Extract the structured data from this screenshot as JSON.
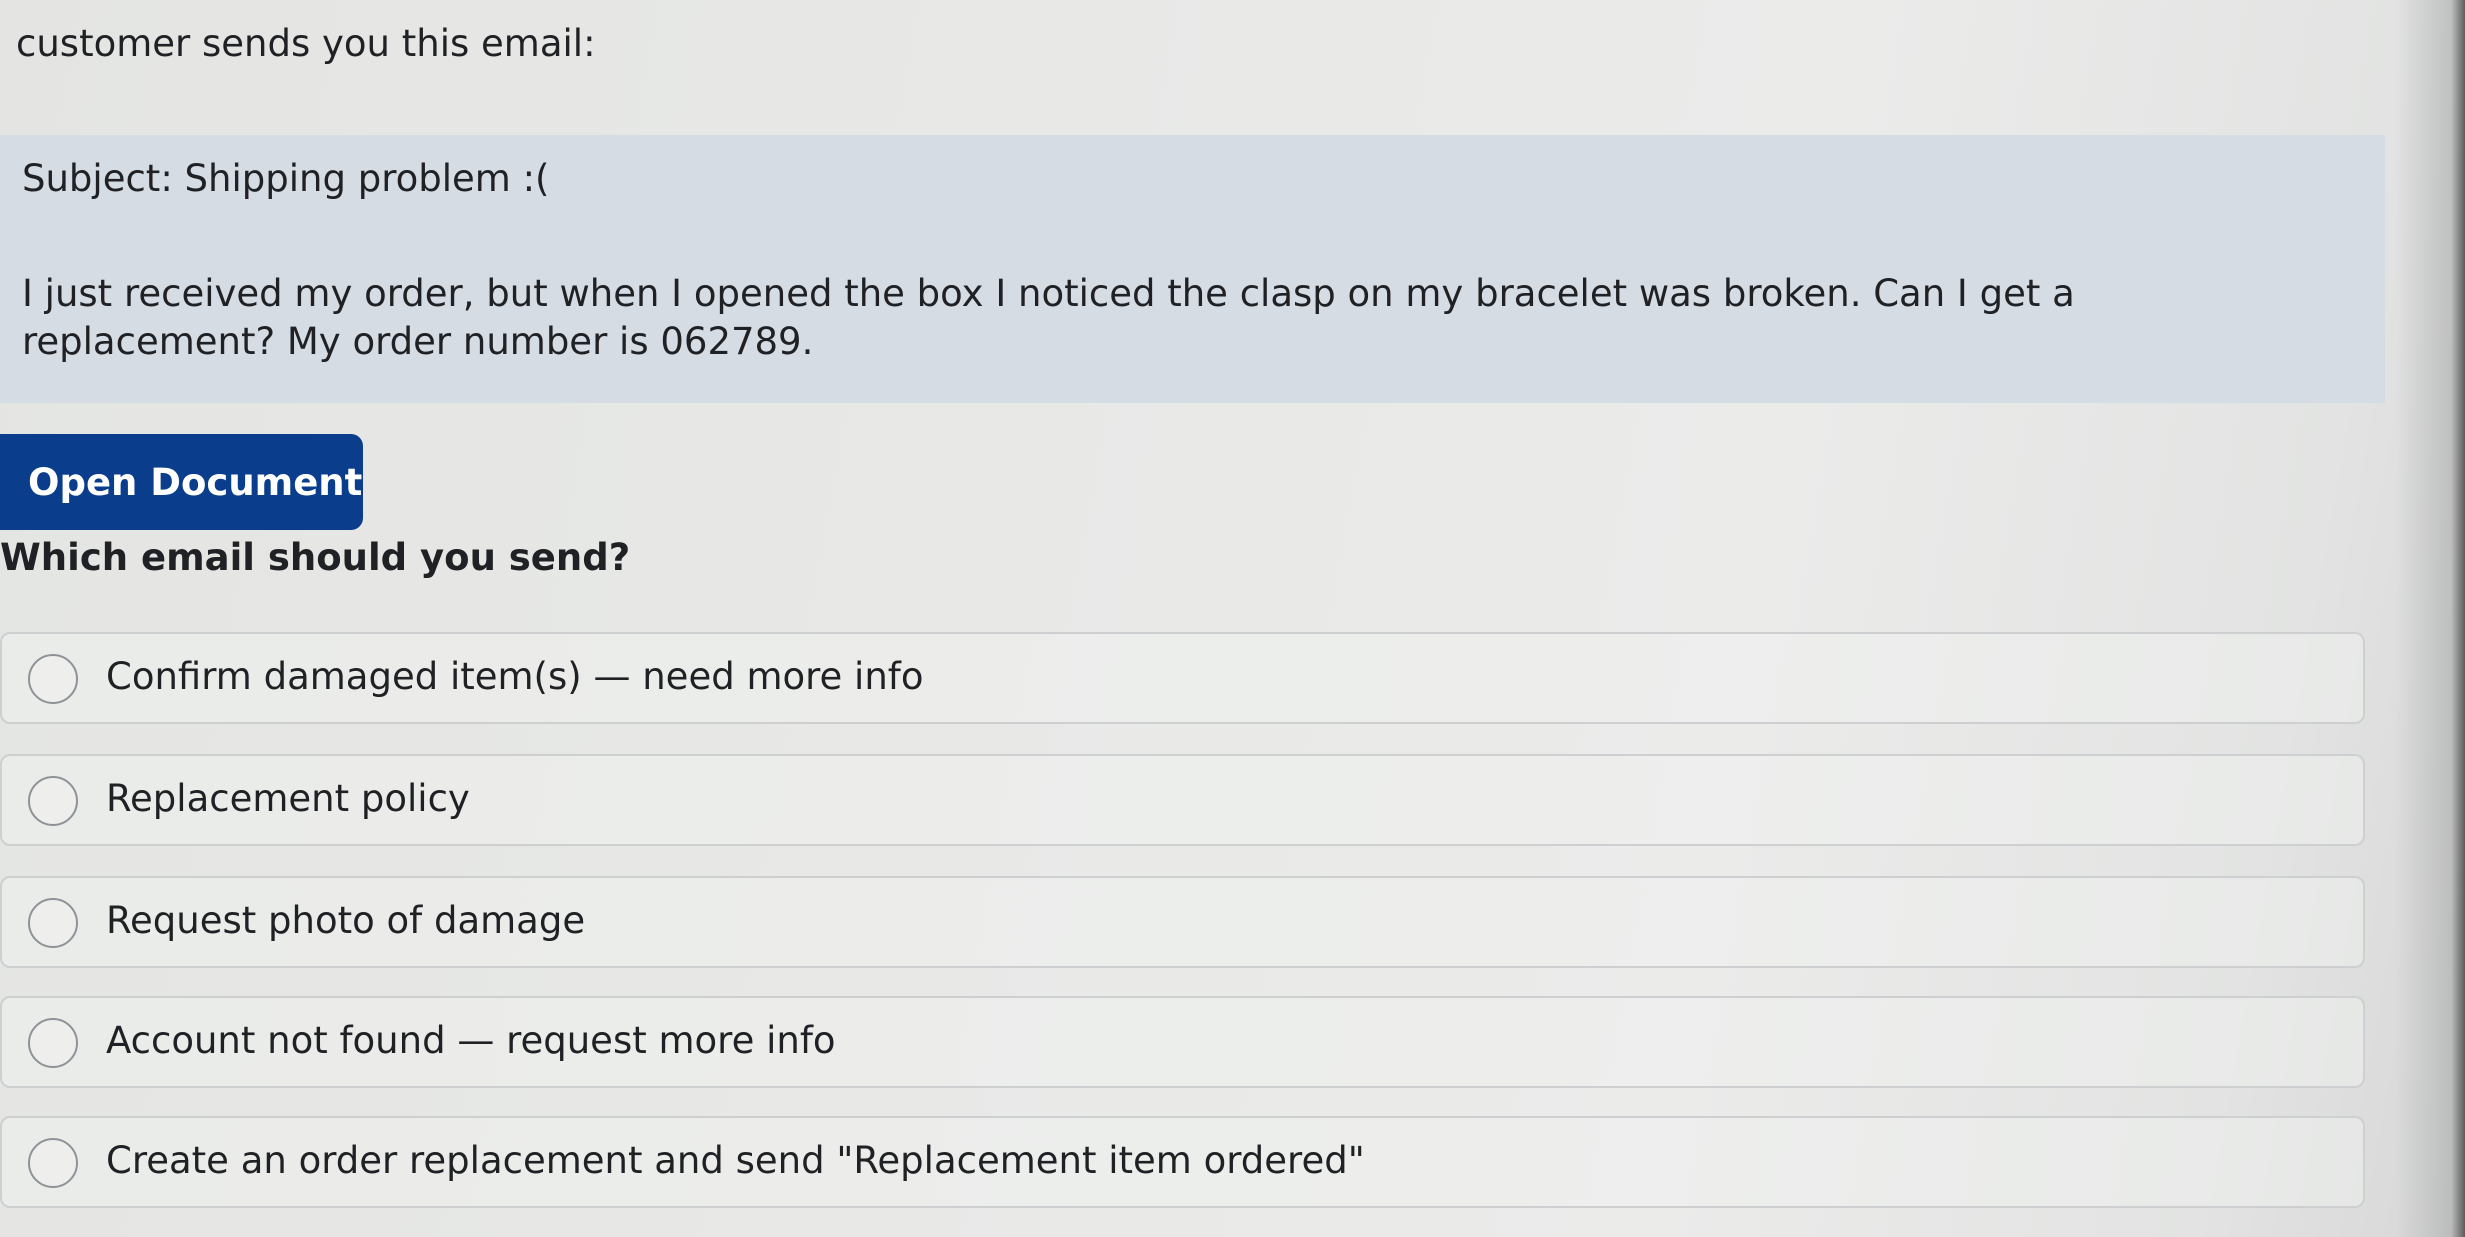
{
  "intro": {
    "text": "customer sends you this email:"
  },
  "email": {
    "subject": "Subject: Shipping problem :(",
    "body": "I just received my order, but when I opened the box I noticed the clasp on my bracelet was broken. Can I get a replacement? My order number is 062789."
  },
  "open_document": {
    "label": "Open Document"
  },
  "question": {
    "text": "Which email should you send?"
  },
  "options": [
    {
      "label": "Confirm damaged item(s) — need more info",
      "selected": false
    },
    {
      "label": "Replacement policy",
      "selected": false
    },
    {
      "label": "Request photo of damage",
      "selected": false
    },
    {
      "label": "Account not found — request more info",
      "selected": false
    },
    {
      "label": "Create an order replacement and send \"Replacement item ordered\"",
      "selected": false
    }
  ],
  "colors": {
    "button_bg": "#0a3e8c",
    "email_box_bg": "#d6dce4",
    "option_border": "#cdcfd0"
  }
}
